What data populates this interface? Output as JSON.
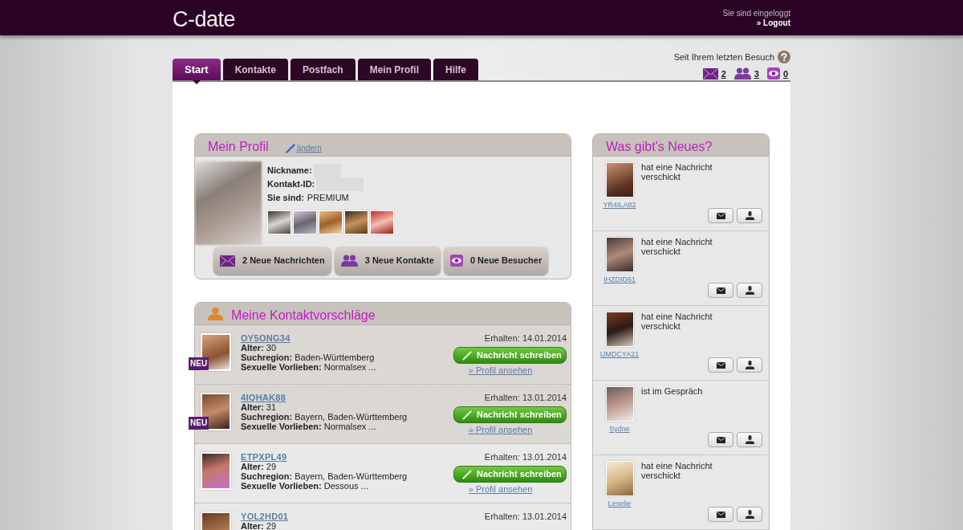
{
  "header": {
    "logo": "C-date",
    "status": "Sie sind eingeloggt",
    "logout": "» Logout"
  },
  "last_visit": {
    "label": "Seit Ihrem letzten Besuch",
    "counters": [
      {
        "kind": "messages",
        "count": "2"
      },
      {
        "kind": "contacts",
        "count": "3"
      },
      {
        "kind": "visitors",
        "count": "0"
      }
    ]
  },
  "tabs": [
    {
      "label": "Start",
      "selected": true
    },
    {
      "label": "Kontakte",
      "selected": false
    },
    {
      "label": "Postfach",
      "selected": false
    },
    {
      "label": "Mein Profil",
      "selected": false
    },
    {
      "label": "Hilfe",
      "selected": false
    }
  ],
  "profile": {
    "title": "Mein Profil",
    "edit_link": "ändern",
    "fields": [
      {
        "label": "Nickname:",
        "redacted": true
      },
      {
        "label": "Kontakt-ID:",
        "redacted": true
      },
      {
        "label": "Sie sind:",
        "value": "PREMIUM",
        "redacted": false
      }
    ],
    "buttons": [
      {
        "kind": "messages",
        "label": "2 Neue Nachrichten"
      },
      {
        "kind": "contacts",
        "label": "3 Neue Kontakte"
      },
      {
        "kind": "visitors",
        "label": "0 Neue Besucher"
      }
    ]
  },
  "suggestions": {
    "title": "Meine Kontaktvorschläge",
    "rows": [
      {
        "name": "OY5ONG34",
        "new": true,
        "badge": "NEU",
        "details": [
          "**Alter:** 30",
          "**Suchregion:** Baden-Württemberg",
          "**Sexuelle Vorlieben:** Normalsex ..."
        ],
        "received": "Erhalten: 14.01.2014",
        "message_button": "Nachricht schreiben",
        "profile_link": "» Profil ansehen"
      },
      {
        "name": "4IQHAK88",
        "new": true,
        "badge": "NEU",
        "details": [
          "**Alter:** 31",
          "**Suchregion:** Bayern, Baden-Württemberg",
          "**Sexuelle Vorlieben:** Normalsex ..."
        ],
        "received": "Erhalten: 13.01.2014",
        "message_button": "Nachricht schreiben",
        "profile_link": "» Profil ansehen"
      },
      {
        "name": "ETPXPL49",
        "new": false,
        "details": [
          "**Alter:** 29",
          "**Suchregion:** Bayern, Baden-Württemberg",
          "**Sexuelle Vorlieben:** Dessous ..."
        ],
        "received": "Erhalten: 13.01.2014",
        "message_button": "Nachricht schreiben",
        "profile_link": "» Profil ansehen"
      },
      {
        "name": "YOL2HD01",
        "new": false,
        "details": [
          "**Alter:** 29"
        ],
        "received": "Erhalten: 13.01.2014"
      }
    ]
  },
  "news": {
    "title": "Was gibt's Neues?",
    "items": [
      {
        "name": "YR4ILA82",
        "text": "hat eine Nachricht verschickt"
      },
      {
        "name": "IHZDID61",
        "text": "hat eine Nachricht verschickt"
      },
      {
        "name": "UMDCYA21",
        "text": "hat eine Nachricht verschickt"
      },
      {
        "name": "Sydne",
        "text": "ist im Gespräch"
      },
      {
        "name": "Leselie",
        "text": "hat eine Nachricht verschickt"
      }
    ]
  }
}
